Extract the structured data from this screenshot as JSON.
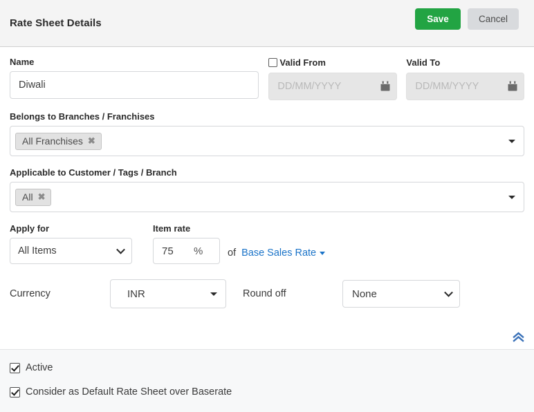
{
  "header": {
    "title": "Rate Sheet Details",
    "save_label": "Save",
    "cancel_label": "Cancel",
    "save_color": "#22a443",
    "cancel_color": "#d8dadd"
  },
  "form": {
    "name": {
      "label": "Name",
      "value": "Diwali",
      "placeholder": ""
    },
    "valid_from": {
      "label": "Valid From",
      "checked": false,
      "value": "",
      "placeholder": "DD/MM/YYYY",
      "disabled": true,
      "icon": "calendar-icon"
    },
    "valid_to": {
      "label": "Valid To",
      "value": "",
      "placeholder": "DD/MM/YYYY",
      "disabled": true,
      "icon": "calendar-icon"
    },
    "branches": {
      "label": "Belongs to Branches / Franchises",
      "tags": [
        "All Franchises"
      ],
      "remove_glyph": "✖",
      "caret": "caret-down-icon"
    },
    "applicable": {
      "label": "Applicable to Customer / Tags / Branch",
      "tags": [
        "All"
      ],
      "remove_glyph": "✖",
      "caret": "caret-down-icon"
    },
    "apply_for": {
      "label": "Apply for",
      "value": "All Items",
      "options": [
        "All Items"
      ]
    },
    "item_rate": {
      "label": "Item rate",
      "value": "75",
      "unit": "%",
      "of_text": "of",
      "base_link": "Base Sales Rate",
      "base_link_color": "#1a73c8"
    },
    "currency": {
      "label": "Currency",
      "value": "INR",
      "options": [
        "INR"
      ]
    },
    "round_off": {
      "label": "Round off",
      "value": "None",
      "options": [
        "None"
      ]
    },
    "collapse": {
      "icon": "double-chevron-up-icon",
      "color": "#3a71b8"
    }
  },
  "footer": {
    "checkboxes": [
      {
        "label": "Active",
        "checked": true
      },
      {
        "label": "Consider as Default Rate Sheet over Baserate",
        "checked": true
      }
    ]
  }
}
